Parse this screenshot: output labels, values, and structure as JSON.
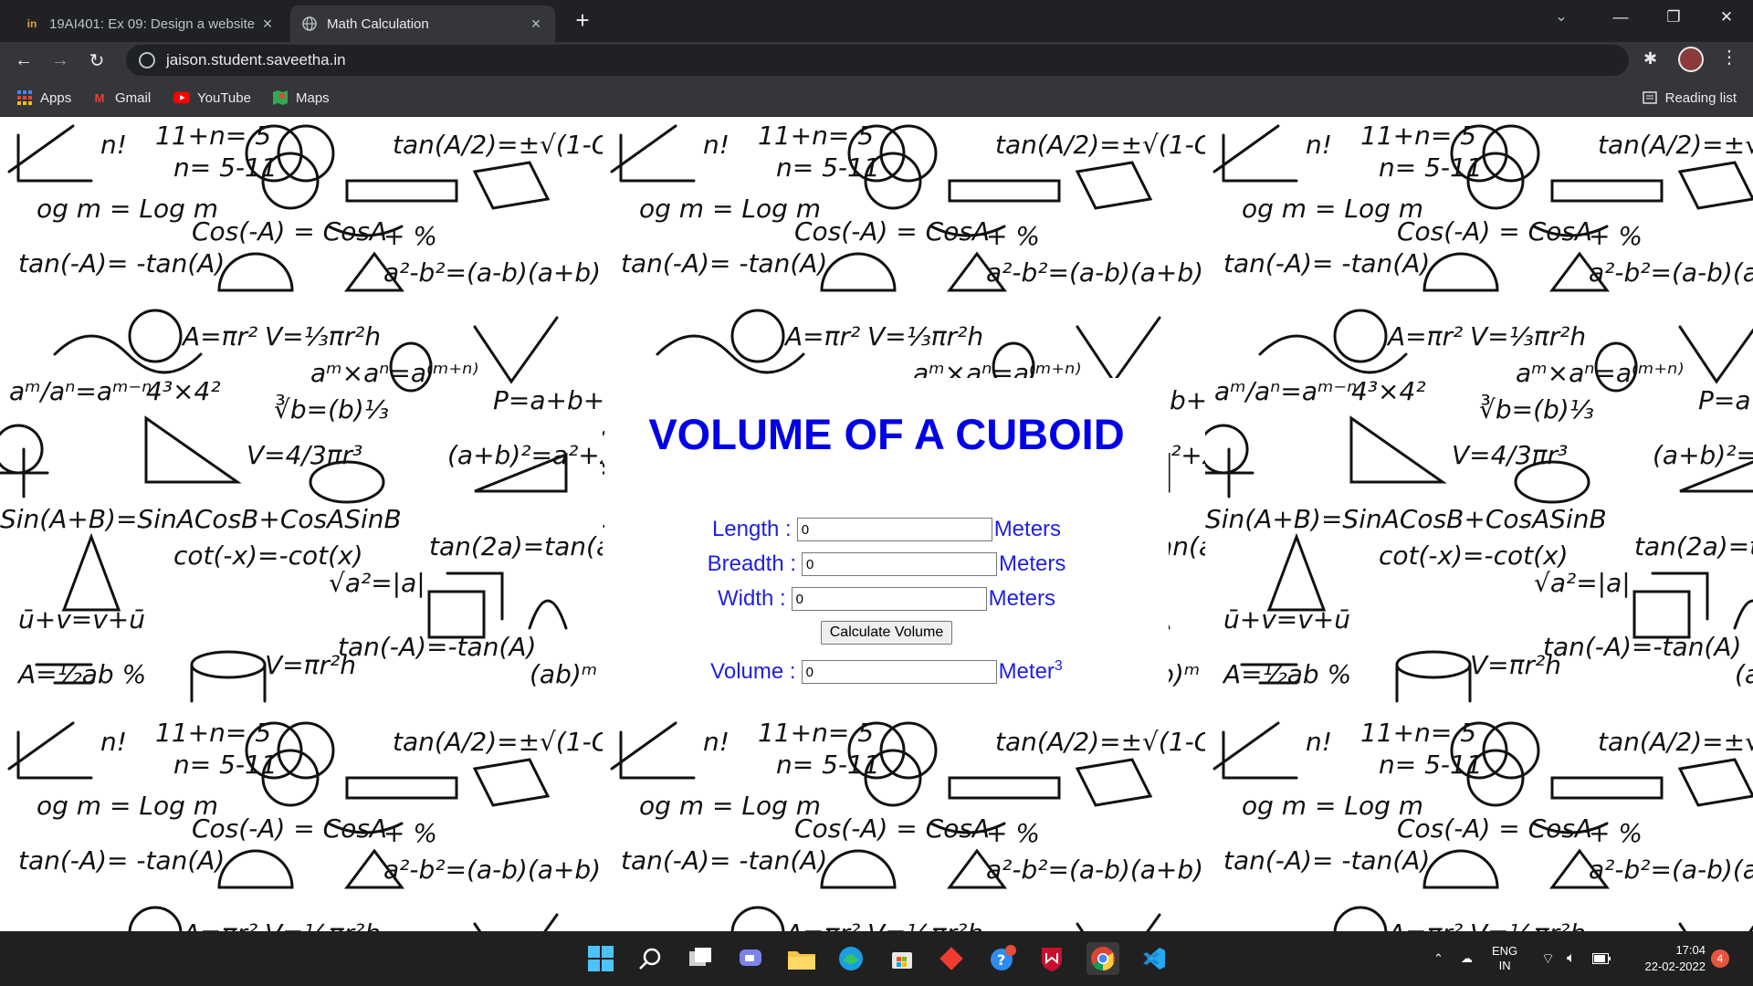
{
  "browser": {
    "tabs": [
      {
        "label": "19AI401: Ex 09: Design a website",
        "active": false,
        "favicon": "in-logo-icon"
      },
      {
        "label": "Math Calculation",
        "active": true,
        "favicon": "globe-icon"
      }
    ],
    "url": "jaison.student.saveetha.in",
    "bookmarks": [
      {
        "label": "Apps",
        "icon": "apps-grid-icon"
      },
      {
        "label": "Gmail",
        "icon": "gmail-icon"
      },
      {
        "label": "YouTube",
        "icon": "youtube-icon"
      },
      {
        "label": "Maps",
        "icon": "maps-icon"
      }
    ],
    "reading_list": "Reading list"
  },
  "page": {
    "heading": "VOLUME OF A CUBOID",
    "fields": [
      {
        "label": "Length :",
        "value": "0",
        "unit": "Meters"
      },
      {
        "label": "Breadth :",
        "value": "0",
        "unit": "Meters"
      },
      {
        "label": "Width :",
        "value": "0",
        "unit": "Meters"
      }
    ],
    "button": "Calculate Volume",
    "result": {
      "label": "Volume :",
      "value": "0",
      "unit": "Meter",
      "unit_sup": "3"
    },
    "colors": {
      "heading": "#0000e6",
      "labels": "#1f1fe0"
    }
  },
  "taskbar": {
    "apps": [
      "windows-start-icon",
      "search-icon",
      "task-view-icon",
      "teams-chat-icon",
      "file-explorer-icon",
      "edge-icon",
      "store-icon",
      "git-icon",
      "help-icon",
      "mcafee-icon",
      "chrome-icon",
      "vscode-icon"
    ],
    "lang_top": "ENG",
    "lang_bottom": "IN",
    "time": "17:04",
    "date": "22-02-2022",
    "notifications": "4"
  }
}
